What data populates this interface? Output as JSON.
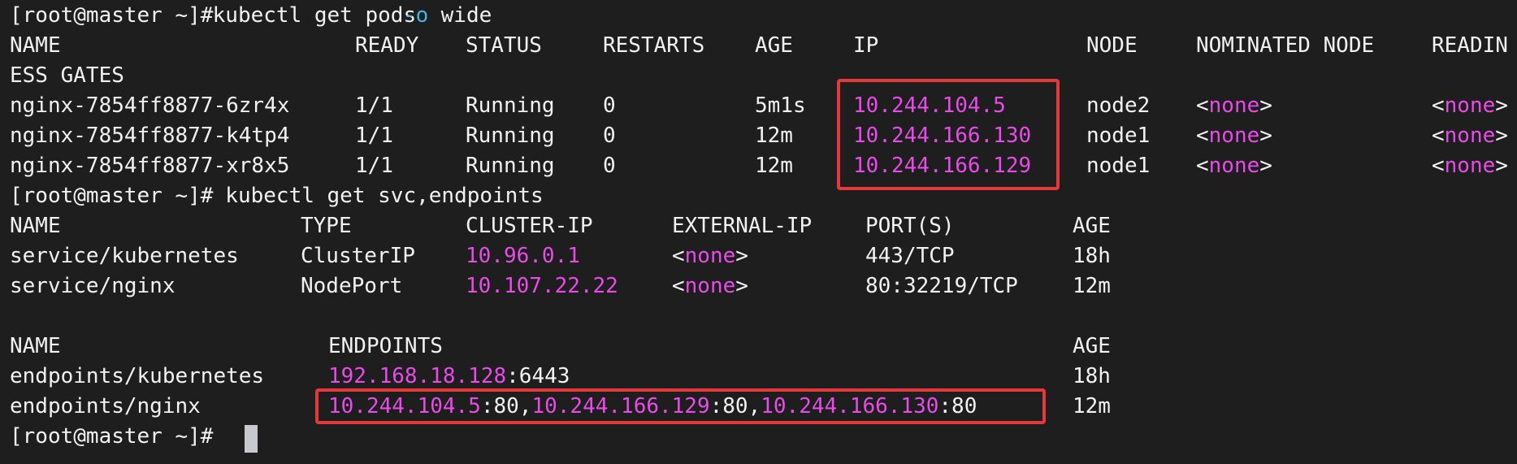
{
  "terminal": {
    "colors": {
      "background": "#1e1e1e",
      "foreground": "#f2f2f2",
      "ip_highlight": "#e84be8",
      "flag": "#3fb6e6",
      "annotation_box": "#e5383b"
    },
    "cmd1": {
      "prompt": "[root@master ~]#",
      "text": " kubectl get pods ",
      "flag": "-o",
      "arg": " wide"
    },
    "pods": {
      "headers": [
        "NAME",
        "READY",
        "STATUS",
        "RESTARTS",
        "AGE",
        "IP",
        "NODE",
        "NOMINATED NODE",
        "READIN"
      ],
      "header_wrap": "ESS GATES",
      "rows": [
        {
          "name": "nginx-7854ff8877-6zr4x",
          "ready": "1/1",
          "status": "Running",
          "restarts": "0",
          "age": "5m1s",
          "ip": "10.244.104.5",
          "node": "node2",
          "nominated": "none",
          "readiness": "none"
        },
        {
          "name": "nginx-7854ff8877-k4tp4",
          "ready": "1/1",
          "status": "Running",
          "restarts": "0",
          "age": "12m",
          "ip": "10.244.166.130",
          "node": "node1",
          "nominated": "none",
          "readiness": "none"
        },
        {
          "name": "nginx-7854ff8877-xr8x5",
          "ready": "1/1",
          "status": "Running",
          "restarts": "0",
          "age": "12m",
          "ip": "10.244.166.129",
          "node": "node1",
          "nominated": "none",
          "readiness": "none"
        }
      ]
    },
    "cmd2": {
      "prompt": "[root@master ~]#",
      "text": "  kubectl get svc,endpoints"
    },
    "svc": {
      "headers": [
        "NAME",
        "TYPE",
        "CLUSTER-IP",
        "EXTERNAL-IP",
        "PORT(S)",
        "AGE"
      ],
      "rows": [
        {
          "name": "service/kubernetes",
          "type": "ClusterIP",
          "cluster_ip": "10.96.0.1",
          "external_ip": "none",
          "ports": "443/TCP",
          "age": "18h"
        },
        {
          "name": "service/nginx",
          "type": "NodePort",
          "cluster_ip": "10.107.22.22",
          "external_ip": "none",
          "ports": "80:32219/TCP",
          "age": "12m"
        }
      ]
    },
    "ep": {
      "headers": [
        "NAME",
        "ENDPOINTS",
        "AGE"
      ],
      "rows": [
        {
          "name": "endpoints/kubernetes",
          "age": "18h",
          "endpoints": [
            {
              "ip": "192.168.18.128",
              "port": ":6443"
            }
          ]
        },
        {
          "name": "endpoints/nginx",
          "age": "12m",
          "endpoints": [
            {
              "ip": "10.244.104.5",
              "port": ":80,"
            },
            {
              "ip": "10.244.166.129",
              "port": ":80,"
            },
            {
              "ip": "10.244.166.130",
              "port": ":80"
            }
          ]
        }
      ]
    },
    "cmd3": {
      "prompt": "[root@master ~]#"
    },
    "lt": "<",
    "gt": ">"
  }
}
